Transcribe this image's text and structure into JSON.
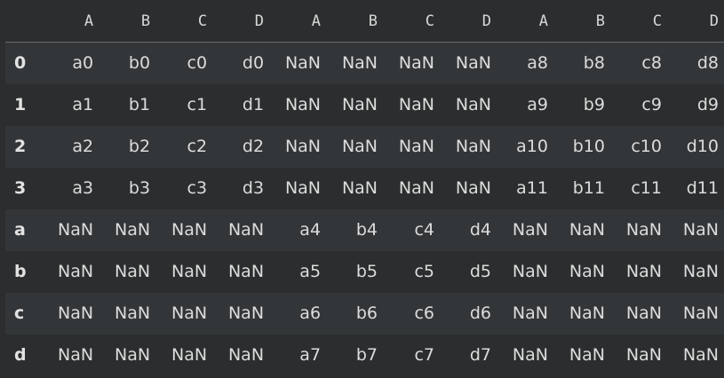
{
  "columns": [
    "A",
    "B",
    "C",
    "D",
    "A",
    "B",
    "C",
    "D",
    "A",
    "B",
    "C",
    "D"
  ],
  "rows": [
    {
      "index": "0",
      "cells": [
        "a0",
        "b0",
        "c0",
        "d0",
        "NaN",
        "NaN",
        "NaN",
        "NaN",
        "a8",
        "b8",
        "c8",
        "d8"
      ]
    },
    {
      "index": "1",
      "cells": [
        "a1",
        "b1",
        "c1",
        "d1",
        "NaN",
        "NaN",
        "NaN",
        "NaN",
        "a9",
        "b9",
        "c9",
        "d9"
      ]
    },
    {
      "index": "2",
      "cells": [
        "a2",
        "b2",
        "c2",
        "d2",
        "NaN",
        "NaN",
        "NaN",
        "NaN",
        "a10",
        "b10",
        "c10",
        "d10"
      ]
    },
    {
      "index": "3",
      "cells": [
        "a3",
        "b3",
        "c3",
        "d3",
        "NaN",
        "NaN",
        "NaN",
        "NaN",
        "a11",
        "b11",
        "c11",
        "d11"
      ]
    },
    {
      "index": "a",
      "cells": [
        "NaN",
        "NaN",
        "NaN",
        "NaN",
        "a4",
        "b4",
        "c4",
        "d4",
        "NaN",
        "NaN",
        "NaN",
        "NaN"
      ]
    },
    {
      "index": "b",
      "cells": [
        "NaN",
        "NaN",
        "NaN",
        "NaN",
        "a5",
        "b5",
        "c5",
        "d5",
        "NaN",
        "NaN",
        "NaN",
        "NaN"
      ]
    },
    {
      "index": "c",
      "cells": [
        "NaN",
        "NaN",
        "NaN",
        "NaN",
        "a6",
        "b6",
        "c6",
        "d6",
        "NaN",
        "NaN",
        "NaN",
        "NaN"
      ]
    },
    {
      "index": "d",
      "cells": [
        "NaN",
        "NaN",
        "NaN",
        "NaN",
        "a7",
        "b7",
        "c7",
        "d7",
        "NaN",
        "NaN",
        "NaN",
        "NaN"
      ]
    }
  ],
  "colors": {
    "background": "#2b2d2e",
    "row_stripe": "#333638",
    "text": "#dcdcdc",
    "header_rule": "#6a6c6e"
  }
}
